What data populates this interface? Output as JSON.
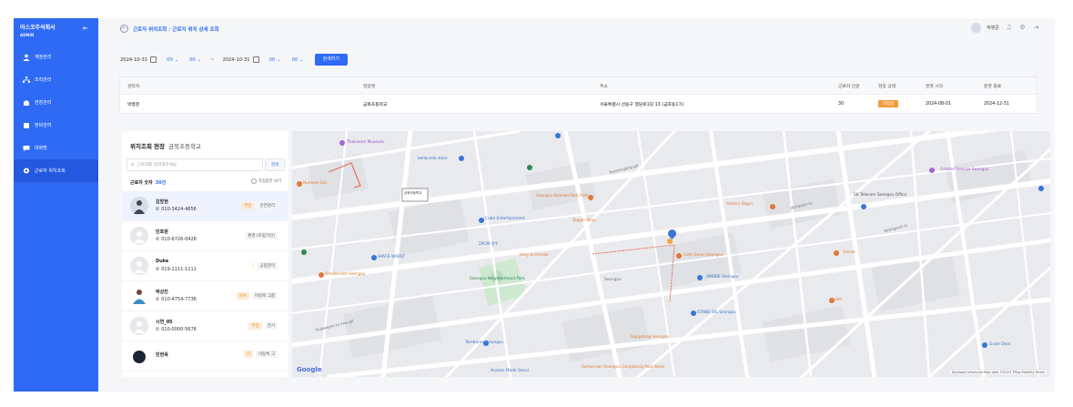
{
  "sidebar": {
    "brand": "아스코주식회사",
    "brand_sub": "ADMIN",
    "items": [
      {
        "label": "계정관리",
        "icon": "person-icon"
      },
      {
        "label": "조직관리",
        "icon": "org-icon"
      },
      {
        "label": "현장관리",
        "icon": "site-icon"
      },
      {
        "label": "장비관리",
        "icon": "device-icon"
      },
      {
        "label": "대화방",
        "icon": "chat-icon"
      },
      {
        "label": "근로자 위치조회",
        "icon": "location-icon"
      }
    ]
  },
  "header": {
    "breadcrumb_1": "근로자 위치조회",
    "breadcrumb_2": "근로자 위치 상세 조회",
    "user_name": "박병준"
  },
  "filters": {
    "start_date": "2024-10-31",
    "start_hour": "00",
    "start_min": "00",
    "tilde": "~",
    "end_date": "2024-10-31",
    "end_hour": "00",
    "end_min": "00",
    "search_label": "검색하기"
  },
  "info_table": {
    "headers": [
      "관리자",
      "현장명",
      "주소",
      "근로자 인원",
      "현장 상태",
      "운영 시작",
      "운영 종료"
    ],
    "row": {
      "manager": "박병준",
      "site": "금북초등학교",
      "address": "서울특별시 성동구 행당로1길 13 (금호동1가)",
      "workers": "30",
      "status": "작업중",
      "start": "2024-08-01",
      "end": "2024-12-31"
    }
  },
  "panel": {
    "title": "위치조회 현장",
    "site_name": "금북초등학교",
    "search_placeholder": "근로자를 입력해주세요.",
    "search_button": "검색",
    "count_label": "근로자 숫자",
    "count_value": "30건",
    "toggle_label": "작업중만 보기",
    "workers": [
      {
        "name": "김방현",
        "phone": "010-3424-4856",
        "tags": [
          "부장",
          "안전관리"
        ],
        "tag_styles": [
          "orange",
          "plain"
        ],
        "avatar": "photo"
      },
      {
        "name": "민호원",
        "phone": "010-6726-0428",
        "tags": [
          "",
          "환경 (조립가인)"
        ],
        "tag_styles": [
          "none",
          "plain"
        ],
        "avatar": "blank"
      },
      {
        "name": "Duke",
        "phone": "019-1111-1111",
        "tags": [
          "",
          "공정관리"
        ],
        "tag_styles": [
          "yellow",
          "plain"
        ],
        "avatar": "blank"
      },
      {
        "name": "박상진",
        "phone": "010-4754-7736",
        "tags": [
          "이사",
          "미팅룩 그룹"
        ],
        "tag_styles": [
          "orange",
          "plain"
        ],
        "avatar": "photo"
      },
      {
        "name": "시연_05",
        "phone": "010-0000-5678",
        "tags": [
          "부장",
          "전기"
        ],
        "tag_styles": [
          "orange",
          "plain"
        ],
        "avatar": "blank"
      },
      {
        "name": "민현욱",
        "phone": "",
        "tags": [
          "기",
          "미팅룩 그"
        ],
        "tag_styles": [
          "orange",
          "plain"
        ],
        "avatar": "dark"
      }
    ]
  },
  "map": {
    "google": "Google",
    "attribution": "Keyboard shortcuts   Map data ©2024 TMap Mobility   Terms",
    "labels": {
      "museum": "Ttukseom Museum",
      "bellacella": "bellacella store",
      "numero": "Numero Dos",
      "hanna": "Hanna Holiday",
      "seongsu_braised": "Seongsu Braised Pork Feet",
      "cube": "Cube Entertainment",
      "toggle_shop": "Toggle Shop",
      "zscm": "29CM 성수",
      "spacewadiz": "SPACE WADIZ",
      "breadsmith": "Breadsmith Seongsu",
      "hary": "Hary & Onedar",
      "seongsu_park": "Seongsu Neighborhood Park",
      "tambourins": "Tamburins Seongsu",
      "human_made": "Human Made Seoul",
      "somunnan": "Somunnan Seongsu Gamjatang Pork Bone",
      "cafe_onion": "Cafe Onion Seongsu",
      "xmore": "XMORE Seongsu",
      "stand_oil": "STAND OIL Seongsu",
      "gguldang": "Ggupdang Seongsu",
      "kokkiri": "Kokkiri Bagel",
      "sk_telecom": "SK Telecom Seongsu Office",
      "ground": "Ground Seesaw Seongsu",
      "gimsa": "Gimsa",
      "gram": "Gram Deal",
      "ode": "ode",
      "jeonju": "Jeonju",
      "seongsu_station": "Seongsu",
      "yeonmujang": "Yeonmujang-gil",
      "achasan": "Achasan-ro",
      "seongsuil": "Seongsuil-ro",
      "ttukseom": "Ttukseom-ro 1na-gil",
      "seongsu_station_label": "성수역"
    }
  }
}
